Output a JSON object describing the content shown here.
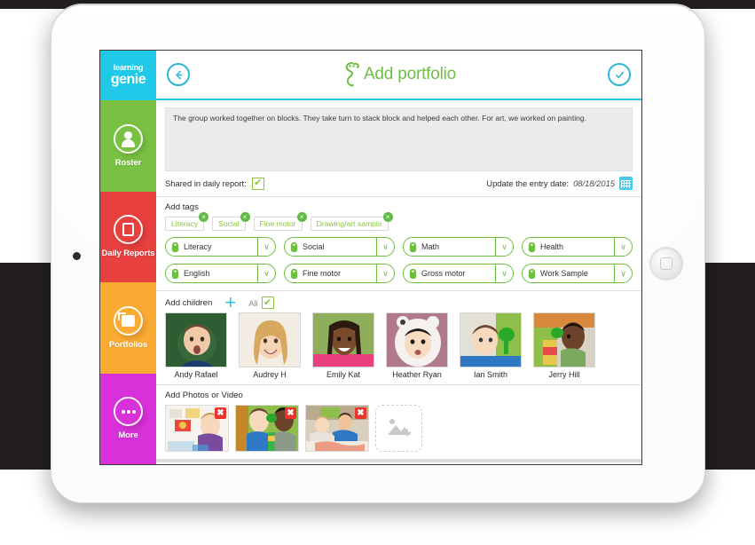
{
  "brand": {
    "logo_line1": "learning",
    "logo_line2": "genie",
    "accent_cyan": "#20c9e8",
    "accent_green": "#6fbe44"
  },
  "sidebar": {
    "items": [
      {
        "label": "Roster",
        "icon": "person-icon",
        "color": "#7ac143"
      },
      {
        "label": "Daily Reports",
        "icon": "book-icon",
        "color": "#e8403e"
      },
      {
        "label": "Portfolios",
        "icon": "folder-icon",
        "color": "#f9ab33"
      },
      {
        "label": "More",
        "icon": "ellipsis-icon",
        "color": "#d931d9"
      }
    ]
  },
  "header": {
    "back_icon": "arrow-left-icon",
    "title": "Add portfolio",
    "logo_icon": "genie-logo-icon",
    "confirm_icon": "check-circle-icon"
  },
  "note": {
    "text": "The group worked together on blocks. They take turn to stack block and helped each other. For art, we worked on painting."
  },
  "meta": {
    "shared_label": "Shared in daily report:",
    "shared_checked": true,
    "shared_check_glyph": "✔",
    "date_label": "Update the entry date:",
    "date_value": "08/18/2015",
    "calendar_icon": "calendar-icon"
  },
  "tags": {
    "section_label": "Add tags",
    "selected": [
      {
        "label": "Literacy",
        "remove_glyph": "×"
      },
      {
        "label": "Social",
        "remove_glyph": "×"
      },
      {
        "label": "Fine motor",
        "remove_glyph": "×"
      },
      {
        "label": "Drawing/art sample",
        "remove_glyph": "×"
      }
    ],
    "dropdowns": [
      {
        "label": "Literacy"
      },
      {
        "label": "Social"
      },
      {
        "label": "Math"
      },
      {
        "label": "Health"
      },
      {
        "label": "English"
      },
      {
        "label": "Fine motor"
      },
      {
        "label": "Gross motor"
      },
      {
        "label": "Work Sample"
      }
    ],
    "caret_glyph": "∨",
    "tag_icon": "tag-icon"
  },
  "children": {
    "section_label": "Add children",
    "add_glyph": "+",
    "all_label": "All",
    "all_checked": true,
    "all_check_glyph": "✔",
    "list": [
      {
        "name": "Andy Rafael",
        "photo_desc": "boy-green-chalkboard"
      },
      {
        "name": "Audrey H",
        "photo_desc": "girl-blonde-smiling"
      },
      {
        "name": "Emily Kat",
        "photo_desc": "girl-braids-pink-shirt"
      },
      {
        "name": "Heather Ryan",
        "photo_desc": "girl-white-fur-hood"
      },
      {
        "name": "Ian Smith",
        "photo_desc": "boy-green-funnel-toy"
      },
      {
        "name": "Jerry Hill",
        "photo_desc": "boy-blocks-green-cup"
      }
    ]
  },
  "media": {
    "section_label": "Add Photos or Video",
    "remove_glyph": "✖",
    "add_icon": "image-placeholder-icon",
    "photos": [
      {
        "desc": "girl-painting-artwork"
      },
      {
        "desc": "two-boys-green-toys"
      },
      {
        "desc": "children-painting-table"
      }
    ]
  }
}
